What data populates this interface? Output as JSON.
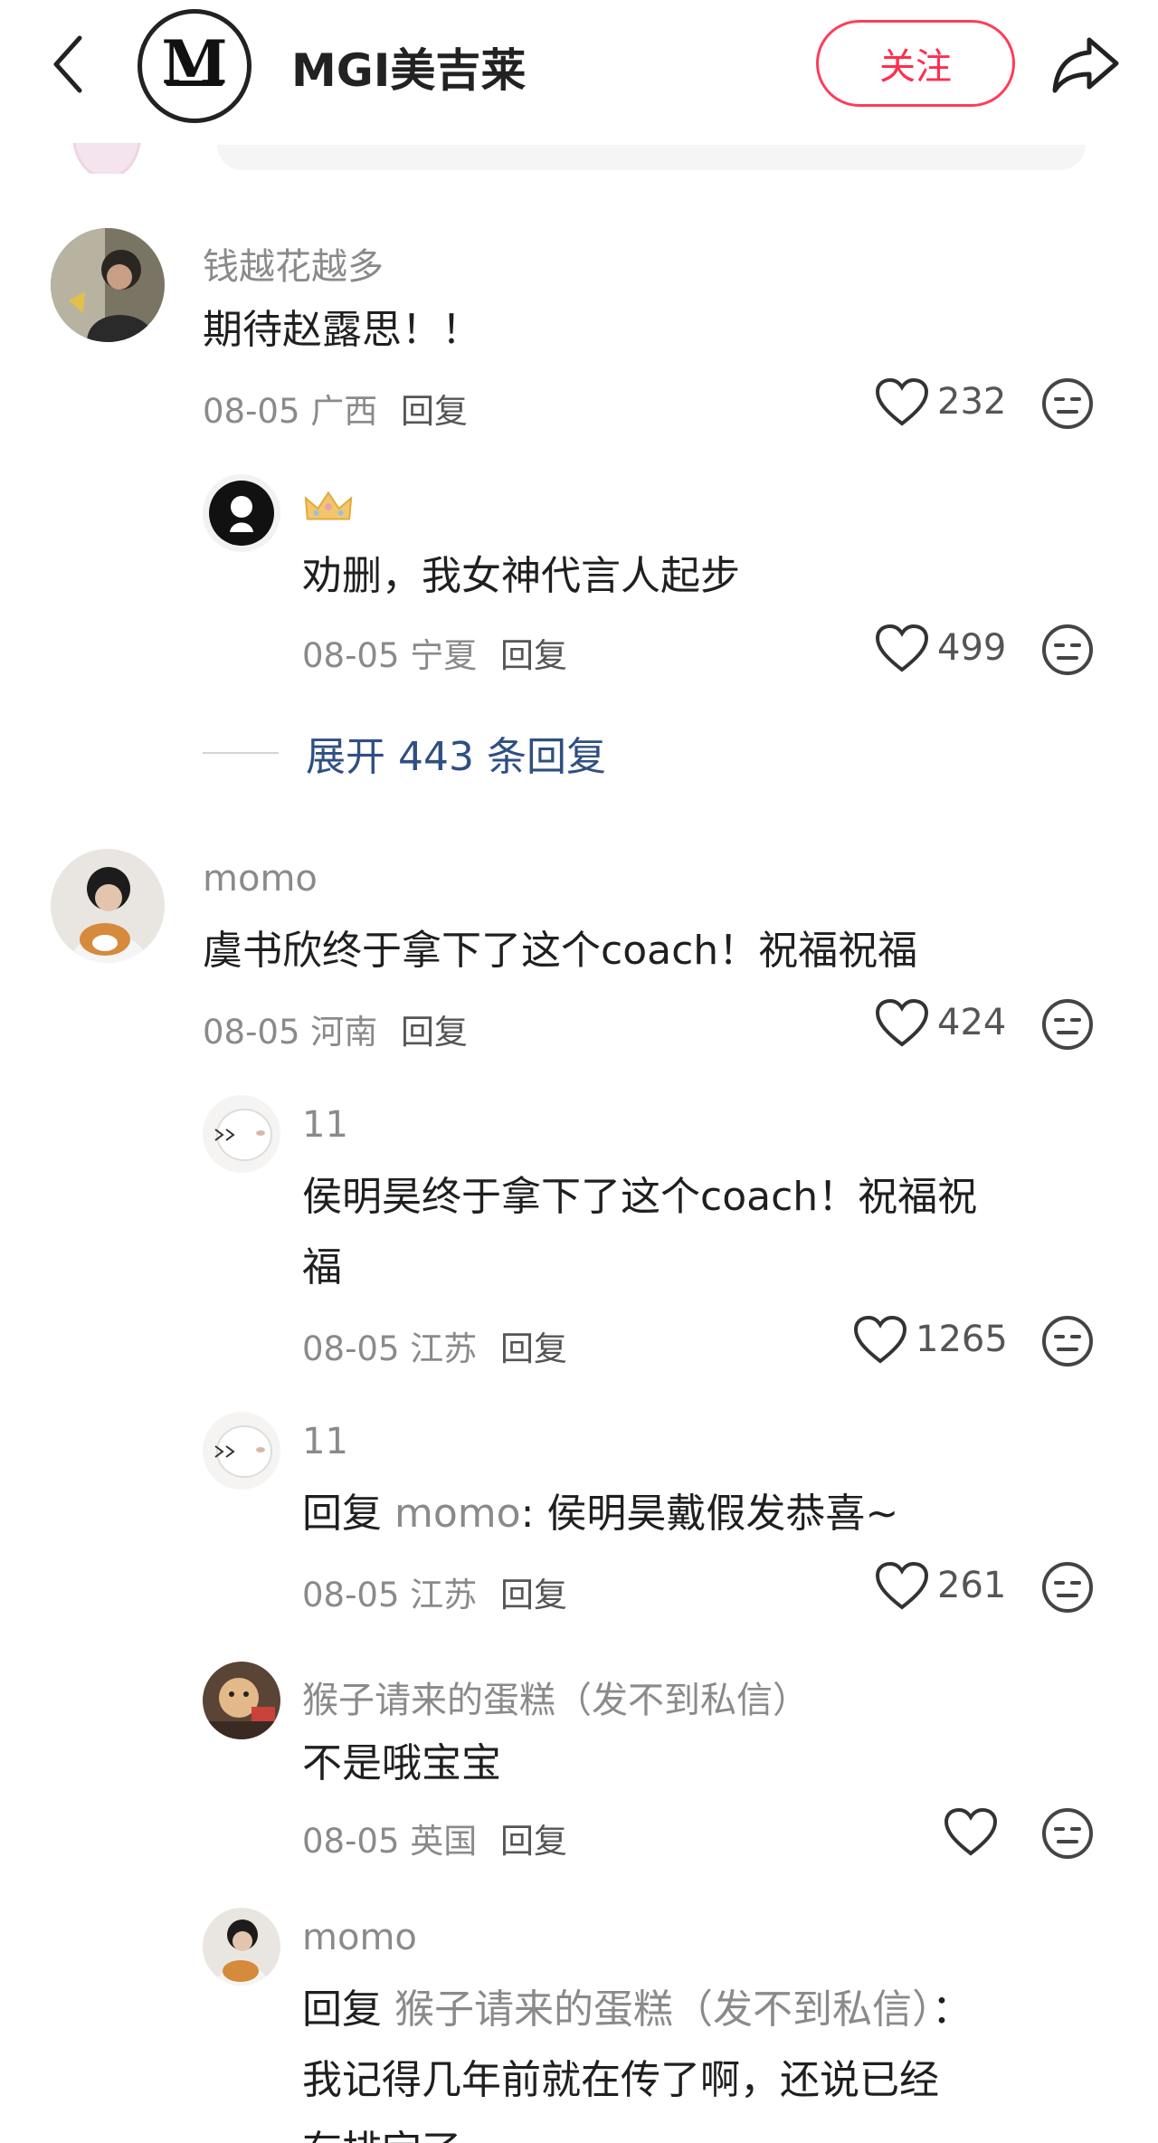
{
  "header": {
    "back_icon": "chevron-left-icon",
    "logo_letter": "M",
    "account_name": "MGI美吉莱",
    "follow_label": "关注",
    "share_icon": "share-arrow-icon",
    "accent": "#ff2e4d"
  },
  "comments": [
    {
      "username": "钱越花越多",
      "text": "期待赵露思！！",
      "date": "08-05",
      "location": "广西",
      "reply_label": "回复",
      "likes": "232",
      "replies": [
        {
          "username": "",
          "badge_icon": "crown-icon",
          "text": "劝删，我女神代言人起步",
          "date": "08-05",
          "location": "宁夏",
          "reply_label": "回复",
          "likes": "499"
        }
      ],
      "expand_label": "展开 443 条回复"
    },
    {
      "username": "momo",
      "text": "虞书欣终于拿下了这个coach！祝福祝福",
      "date": "08-05",
      "location": "河南",
      "reply_label": "回复",
      "likes": "424",
      "replies": [
        {
          "username": "11",
          "text_line1": "侯明昊终于拿下了这个coach！祝福祝",
          "text_line2": "福",
          "date": "08-05",
          "location": "江苏",
          "reply_label": "回复",
          "likes": "1265"
        },
        {
          "username": "11",
          "reply_prefix": "回复",
          "reply_to": "momo",
          "text": ": 侯明昊戴假发恭喜~",
          "date": "08-05",
          "location": "江苏",
          "reply_label": "回复",
          "likes": "261"
        },
        {
          "username": "猴子请来的蛋糕（发不到私信）",
          "text": "不是哦宝宝",
          "date": "08-05",
          "location": "英国",
          "reply_label": "回复",
          "likes": ""
        },
        {
          "username": "momo",
          "reply_prefix": "回复",
          "reply_to": "猴子请来的蛋糕（发不到私信）",
          "text_line1_suffix": "：",
          "text_line2": "我记得几年前就在传了啊，还说已经",
          "text_line3": "有排定了"
        }
      ]
    }
  ],
  "icons": {
    "like": "heart-outline-icon",
    "dislike": "meh-face-icon"
  }
}
